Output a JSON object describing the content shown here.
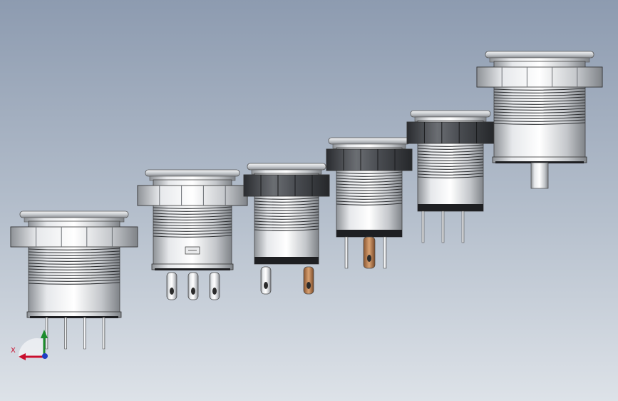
{
  "scene": {
    "type": "cad-3d-viewport",
    "subject": "panel-mount-push-button-switches",
    "part_count": 6,
    "colors": {
      "background_top": "#8d9bb0",
      "background_bottom": "#dde2e8",
      "metal": "#d4d7db",
      "dark_ring": "#3a3c40",
      "pin_copper": "#b07a4a",
      "pin_steel": "#c9ccd0",
      "axis_x": "#c8102e",
      "axis_y": "#1c8c2c",
      "axis_z": "#1f3fc4"
    },
    "parts": [
      {
        "variant": "large-flange-4-pin",
        "ring_color": "metal",
        "pin_style": "round"
      },
      {
        "variant": "solder-lug-3-pin",
        "ring_color": "metal",
        "pin_style": "lug"
      },
      {
        "variant": "dark-nut-2-lug",
        "ring_color": "dark",
        "pin_style": "lug"
      },
      {
        "variant": "dark-nut-blade",
        "ring_color": "dark",
        "pin_style": "blade"
      },
      {
        "variant": "dark-nut-3-pin",
        "ring_color": "dark",
        "pin_style": "round"
      },
      {
        "variant": "large-flange-plunger",
        "ring_color": "metal",
        "pin_style": "plunger"
      }
    ]
  },
  "triad": {
    "x_label": "X"
  }
}
